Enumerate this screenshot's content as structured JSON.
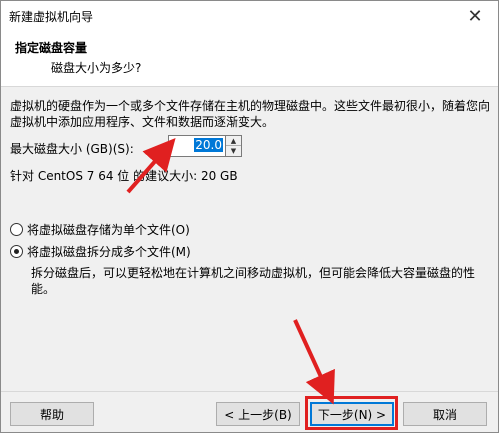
{
  "window": {
    "title": "新建虚拟机向导",
    "close_glyph": "✕"
  },
  "header": {
    "title": "指定磁盘容量",
    "subtitle": "磁盘大小为多少?"
  },
  "content": {
    "description": "虚拟机的硬盘作为一个或多个文件存储在主机的物理磁盘中。这些文件最初很小，随着您向虚拟机中添加应用程序、文件和数据而逐渐变大。",
    "size_label": "最大磁盘大小 (GB)(S):",
    "size_value": "20.0",
    "recommend": "针对 CentOS 7 64 位 的建议大小: 20 GB",
    "radio_single": "将虚拟磁盘存储为单个文件(O)",
    "radio_split": "将虚拟磁盘拆分成多个文件(M)",
    "split_description": "拆分磁盘后，可以更轻松地在计算机之间移动虚拟机，但可能会降低大容量磁盘的性能。",
    "selected_option": "split"
  },
  "footer": {
    "help": "帮助",
    "back": "< 上一步(B)",
    "next": "下一步(N) >",
    "cancel": "取消"
  },
  "colors": {
    "annotation": "#e02020",
    "focus": "#0078d7"
  },
  "icons": {
    "close": "close-icon",
    "spin_up": "spin-up-arrow-icon",
    "spin_down": "spin-down-arrow-icon"
  }
}
